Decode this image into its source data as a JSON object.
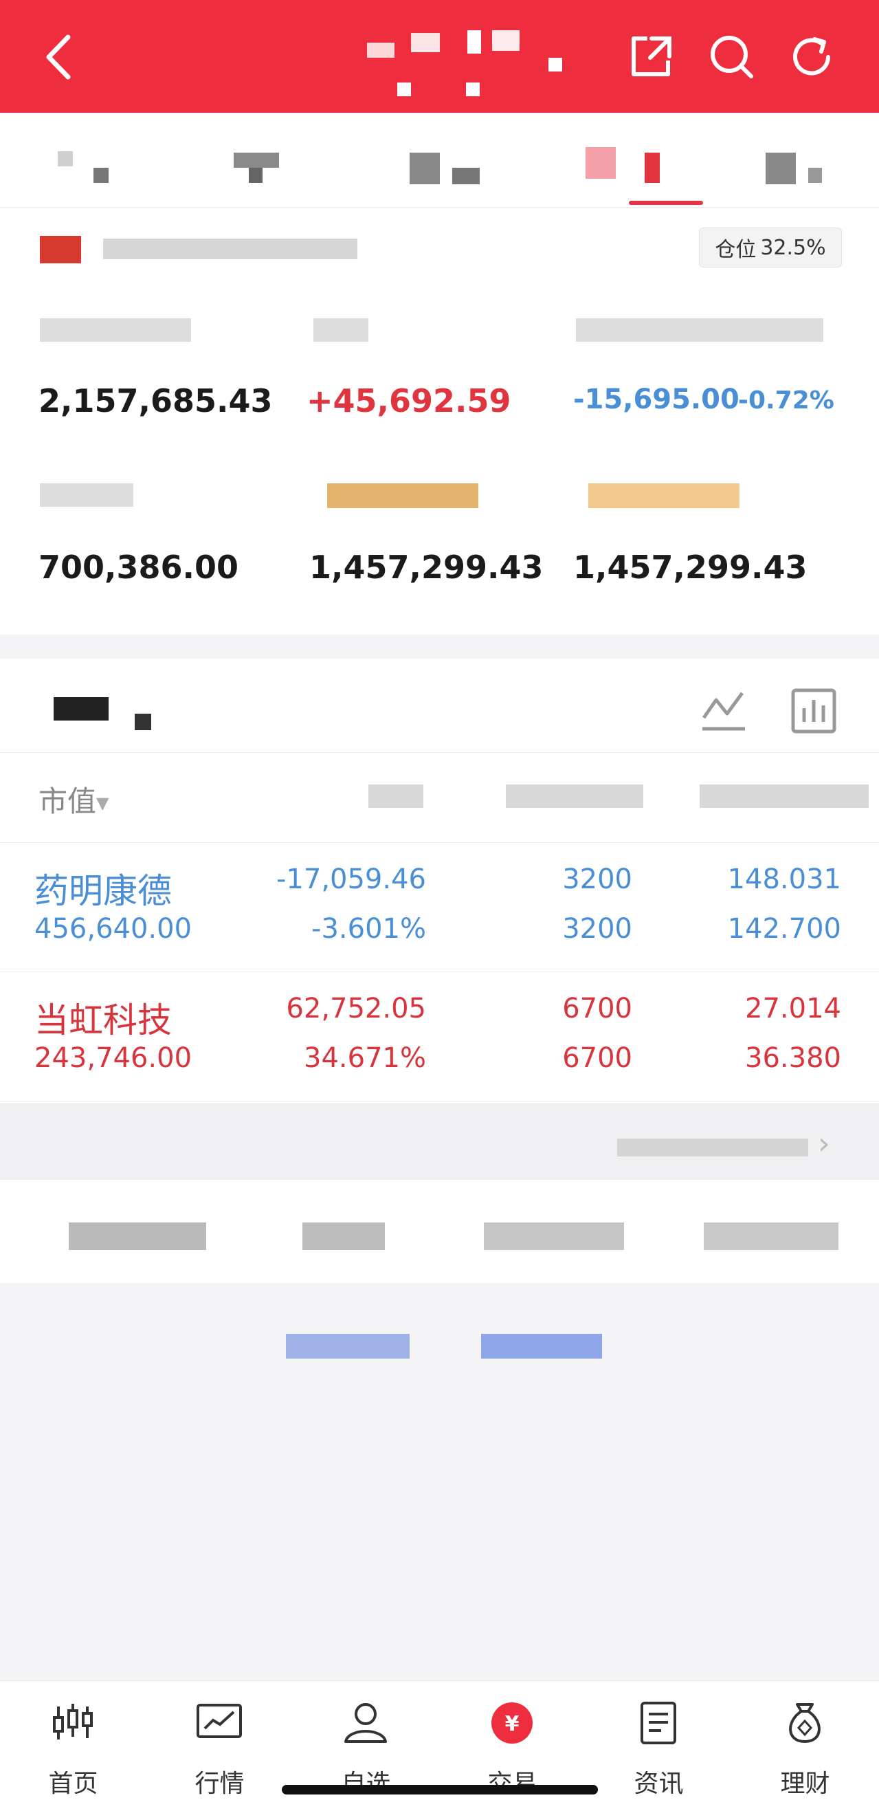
{
  "position_badge": {
    "label": "仓位",
    "value": "32.5%"
  },
  "summary": {
    "values": [
      "2,157,685.43",
      "+45,692.59",
      "-15,695.00",
      "-0.72%",
      "700,386.00",
      "1,457,299.43",
      "1,457,299.43"
    ]
  },
  "holdings": {
    "sort_header": "市值",
    "rows": [
      {
        "name": "药明康德",
        "market_value": "456,640.00",
        "pl": "-17,059.46",
        "pl_pct": "-3.601%",
        "qty1": "3200",
        "qty2": "3200",
        "cost": "148.031",
        "price": "142.700"
      },
      {
        "name": "当虹科技",
        "market_value": "243,746.00",
        "pl": "62,752.05",
        "pl_pct": "34.671%",
        "qty1": "6700",
        "qty2": "6700",
        "cost": "27.014",
        "price": "36.380"
      }
    ]
  },
  "nav": {
    "items": [
      {
        "label": "首页",
        "icon": "candlestick-icon"
      },
      {
        "label": "行情",
        "icon": "trend-chart-icon"
      },
      {
        "label": "自选",
        "icon": "user-star-icon"
      },
      {
        "label": "交易",
        "icon": "yuan-coin-icon"
      },
      {
        "label": "资讯",
        "icon": "document-icon"
      },
      {
        "label": "理财",
        "icon": "money-bag-icon"
      }
    ]
  },
  "colors": {
    "header": "#ee2e3e",
    "gain": "#e0343e",
    "loss": "#4a8fd6"
  }
}
